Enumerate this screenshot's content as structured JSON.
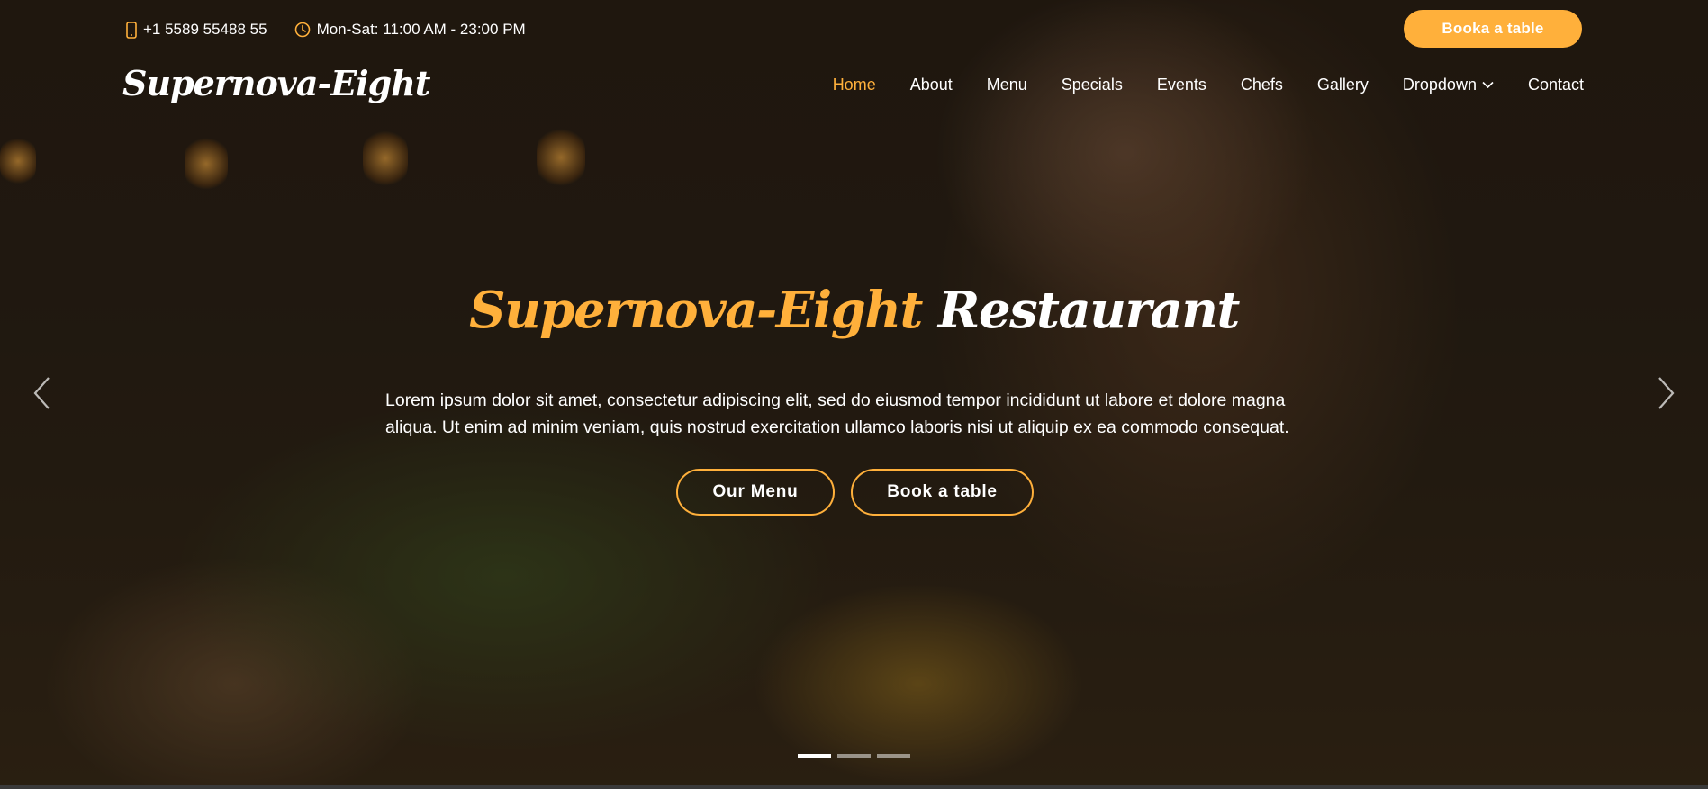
{
  "topbar": {
    "phone": "+1 5589 55488 55",
    "hours": "Mon-Sat: 11:00 AM - 23:00 PM",
    "book_button": "Booka a table"
  },
  "header": {
    "logo": "Supernova-Eight",
    "nav": [
      {
        "label": "Home",
        "active": true
      },
      {
        "label": "About"
      },
      {
        "label": "Menu"
      },
      {
        "label": "Specials"
      },
      {
        "label": "Events"
      },
      {
        "label": "Chefs"
      },
      {
        "label": "Gallery"
      },
      {
        "label": "Dropdown",
        "has_dropdown": true
      },
      {
        "label": "Contact"
      }
    ]
  },
  "hero": {
    "title_brand": "Supernova-Eight",
    "title_rest": "Restaurant",
    "text": "Lorem ipsum dolor sit amet, consectetur adipiscing elit, sed do eiusmod tempor incididunt ut labore et dolore magna aliqua. Ut enim ad minim veniam, quis nostrud exercitation ullamco laboris nisi ut aliquip ex ea commodo consequat.",
    "btn_menu": "Our Menu",
    "btn_book": "Book a table",
    "slides_total": 3,
    "active_slide": 1
  },
  "icons": {
    "phone": "phone-icon",
    "clock": "clock-icon",
    "prev": "chevron-left-icon",
    "next": "chevron-right-icon",
    "dropdown": "chevron-down-icon"
  },
  "colors": {
    "accent": "#ffb03b",
    "text": "#ffffff"
  }
}
